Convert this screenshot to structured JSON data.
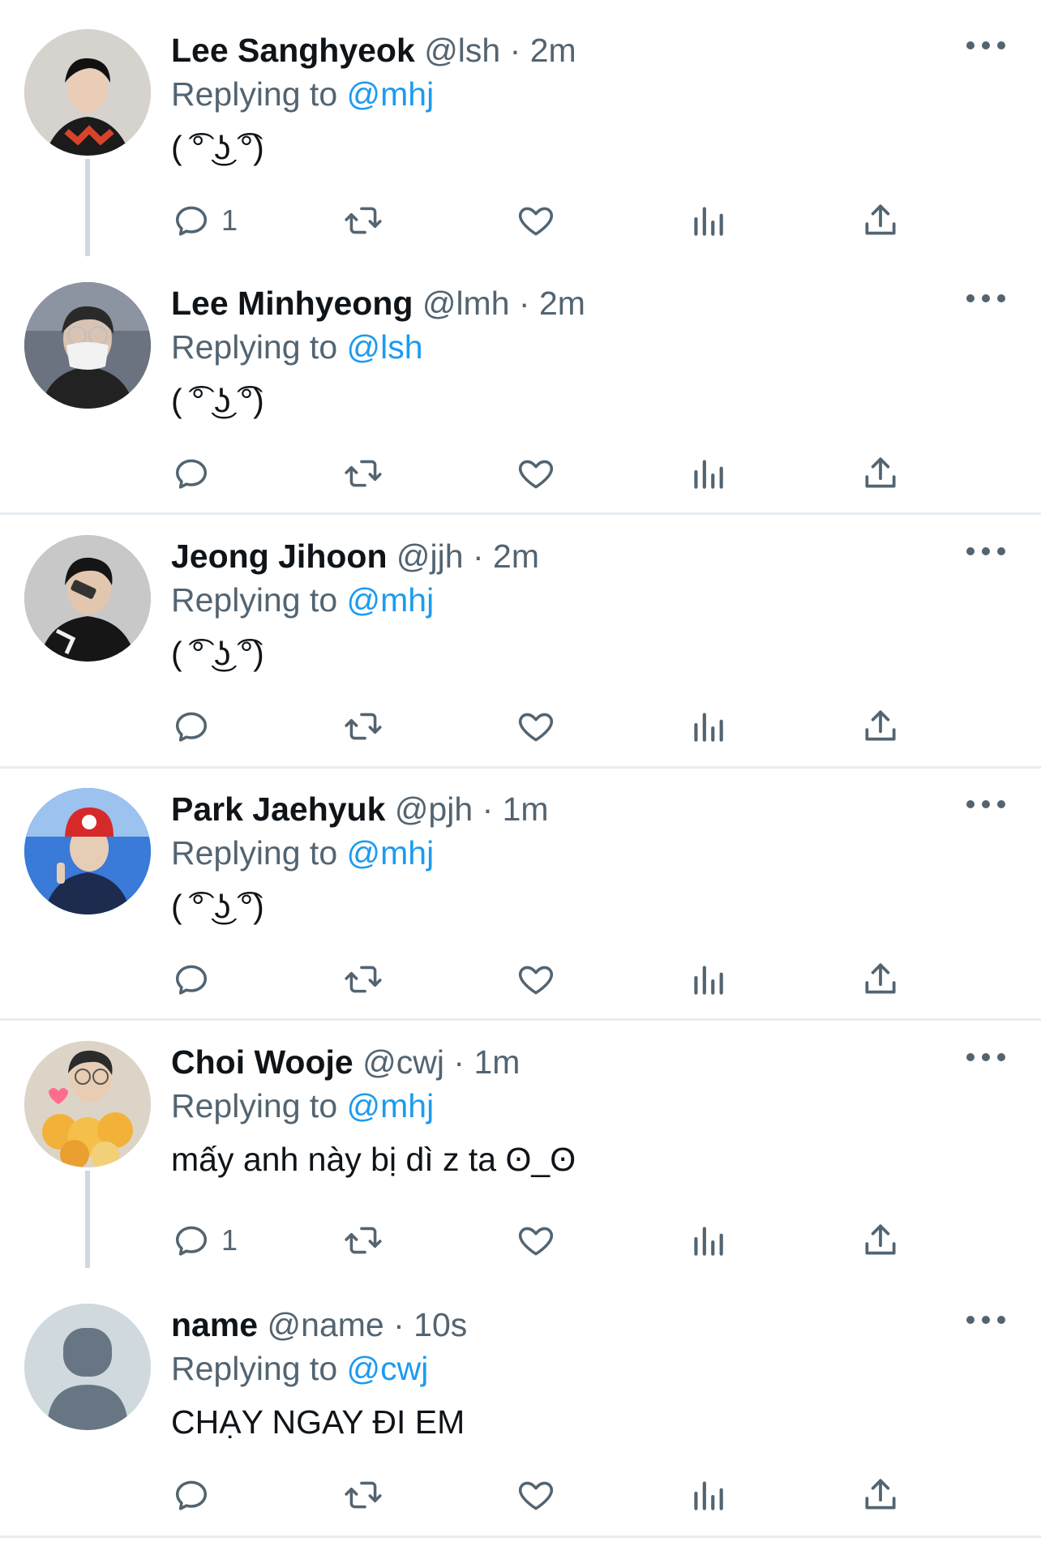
{
  "reply_prefix": "Replying to",
  "tweets": [
    {
      "name": "Lee Sanghyeok",
      "handle": "@lsh",
      "dot": "·",
      "time": "2m",
      "reply_to": "@mhj",
      "text": "( ͡° ͜ʖ ͡°)",
      "reply_count": "1",
      "avatar": "photo-avatar"
    },
    {
      "name": "Lee Minhyeong",
      "handle": "@lmh",
      "dot": "·",
      "time": "2m",
      "reply_to": "@lsh",
      "text": "( ͡° ͜ʖ ͡°)",
      "reply_count": "",
      "avatar": "photo-avatar"
    },
    {
      "name": "Jeong Jihoon",
      "handle": "@jjh",
      "dot": "·",
      "time": "2m",
      "reply_to": "@mhj",
      "text": "( ͡° ͜ʖ ͡°)",
      "reply_count": "",
      "avatar": "photo-avatar"
    },
    {
      "name": "Park Jaehyuk",
      "handle": "@pjh",
      "dot": "·",
      "time": "1m",
      "reply_to": "@mhj",
      "text": "( ͡° ͜ʖ ͡°)",
      "reply_count": "",
      "avatar": "photo-avatar"
    },
    {
      "name": "Choi Wooje",
      "handle": "@cwj",
      "dot": "·",
      "time": "1m",
      "reply_to": "@mhj",
      "text": "mấy anh này bị dì z ta ʘ_ʘ",
      "reply_count": "1",
      "avatar": "photo-avatar"
    },
    {
      "name": "name",
      "handle": "@name",
      "dot": "·",
      "time": "10s",
      "reply_to": "@cwj",
      "text": "CHẠY NGAY ĐI EM",
      "reply_count": "",
      "avatar": "default-person-avatar"
    }
  ],
  "action_icons": [
    "reply-icon",
    "retweet-icon",
    "like-icon",
    "views-icon",
    "share-icon"
  ],
  "colors": {
    "text": "#0f1419",
    "secondary": "#536471",
    "mention": "#1d9bf0",
    "line": "#cfd9de",
    "separator": "#e6ecf0"
  }
}
